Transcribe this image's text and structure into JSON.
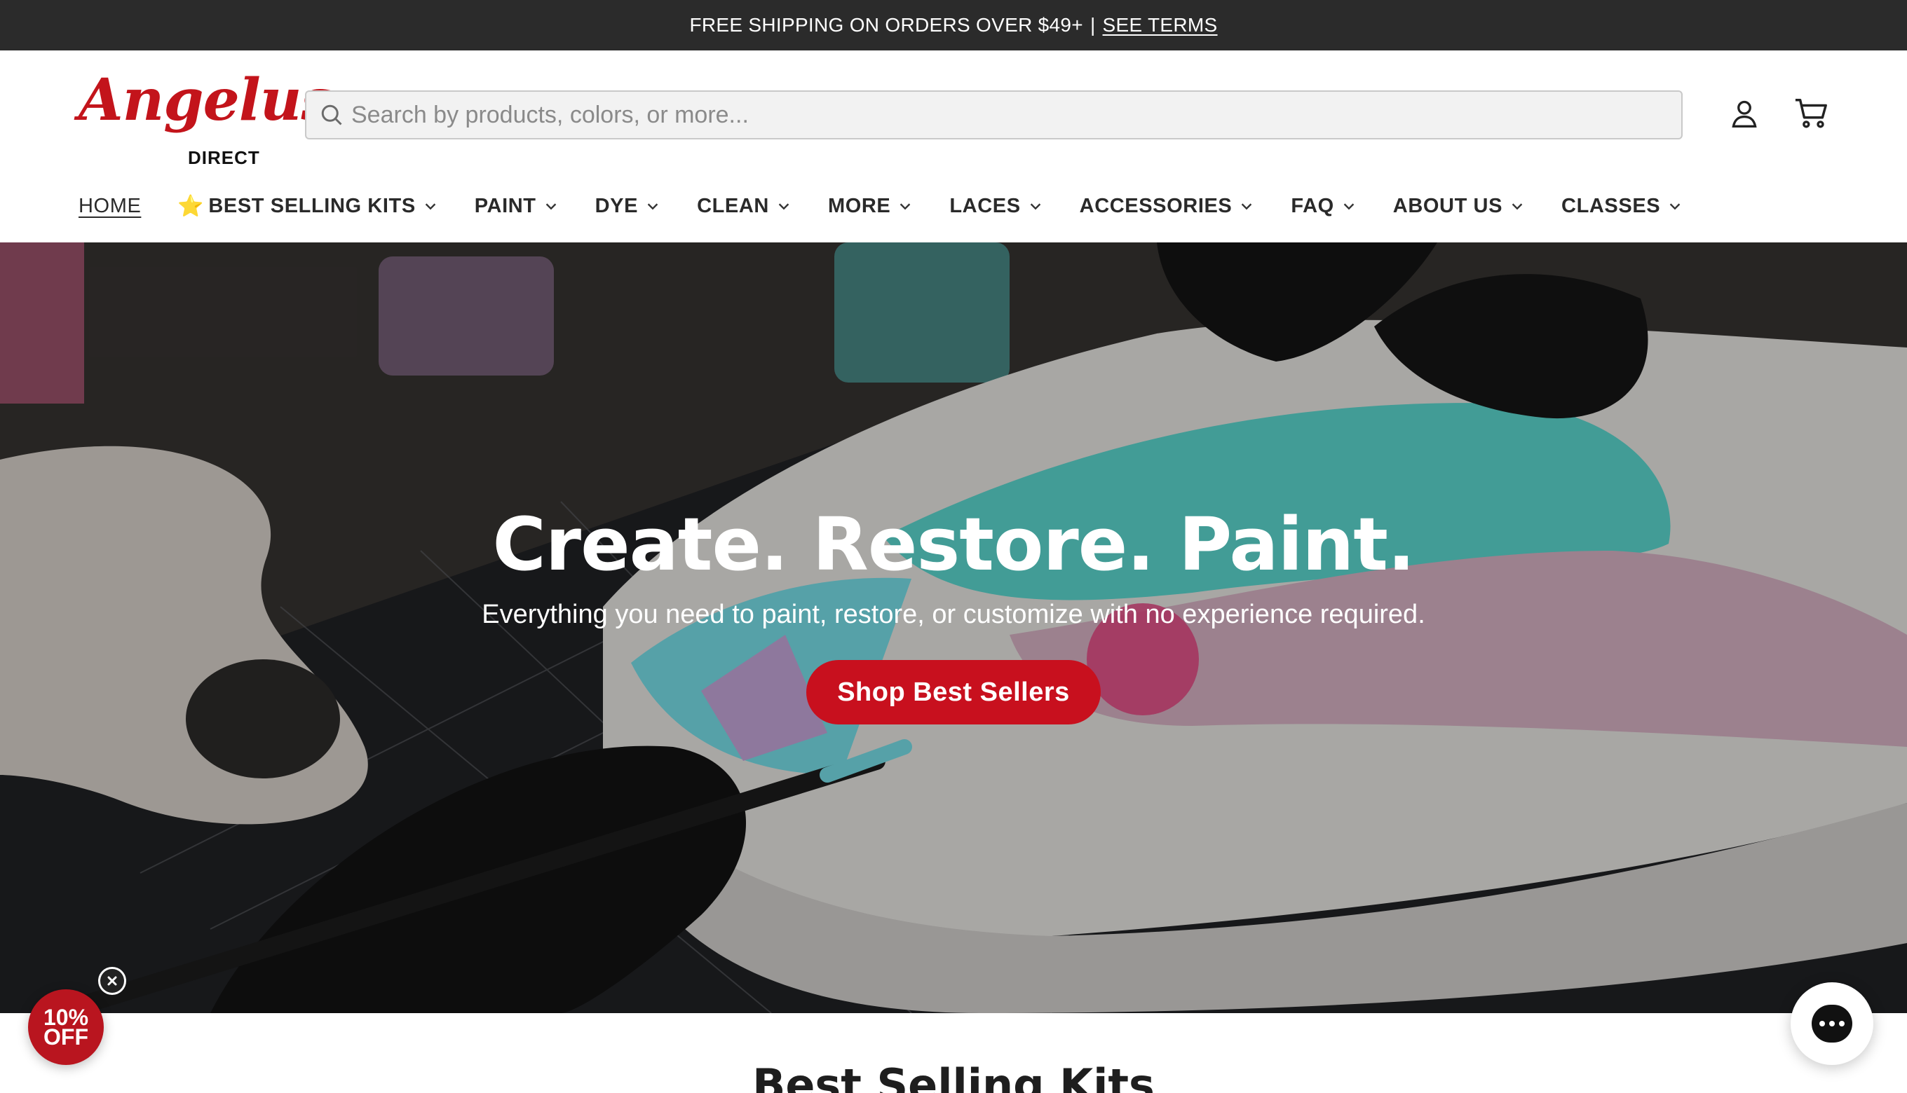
{
  "announcement": {
    "text": "FREE SHIPPING ON ORDERS OVER $49+",
    "separator": "|",
    "link": "SEE TERMS"
  },
  "brand": {
    "name": "Angelus",
    "sub": "DIRECT",
    "color": "#c3141b"
  },
  "search": {
    "placeholder": "Search by products, colors, or more..."
  },
  "nav": {
    "items": [
      {
        "label": "HOME"
      },
      {
        "label": "BEST SELLING KITS"
      },
      {
        "label": "PAINT"
      },
      {
        "label": "DYE"
      },
      {
        "label": "CLEAN"
      },
      {
        "label": "MORE"
      },
      {
        "label": "LACES"
      },
      {
        "label": "ACCESSORIES"
      },
      {
        "label": "FAQ"
      },
      {
        "label": "ABOUT US"
      },
      {
        "label": "CLASSES"
      }
    ]
  },
  "hero": {
    "title": "Create. Restore. Paint.",
    "subtitle": "Everything you need to paint, restore, or customize with no experience required.",
    "cta": "Shop Best Sellers",
    "cta_color": "#c8101e"
  },
  "popup": {
    "line1": "10%",
    "line2": "OFF"
  },
  "section": {
    "title": "Best Selling Kits"
  },
  "icons": [
    "search-icon",
    "account-icon",
    "cart-icon",
    "chevron-down-icon",
    "star-icon",
    "close-icon",
    "chat-icon"
  ]
}
